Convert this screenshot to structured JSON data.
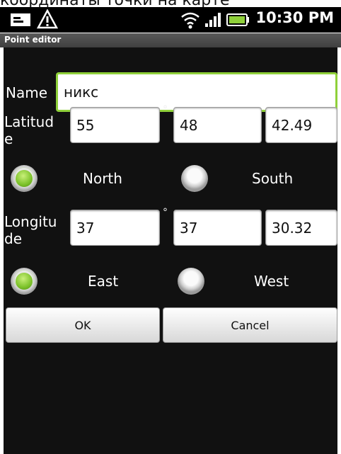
{
  "top_text": "координаты точки на карте",
  "status": {
    "time": "10:30 PM"
  },
  "title": "Point editor",
  "name": {
    "label": "Name",
    "value": "никс"
  },
  "latitude": {
    "label_line1": "Latitud",
    "label_line2": "e",
    "degrees": "55",
    "degree_symbol": "°",
    "minutes": "48",
    "seconds": "42.49",
    "options": [
      "North",
      "South"
    ],
    "selected": "North"
  },
  "longitude": {
    "label_line1": "Longitu",
    "label_line2": "de",
    "degrees": "37",
    "degree_symbol": "°",
    "minutes": "37",
    "seconds": "30.32",
    "options": [
      "East",
      "West"
    ],
    "selected": "East"
  },
  "buttons": {
    "ok": "OK",
    "cancel": "Cancel"
  },
  "colors": {
    "accent": "#8fd03a",
    "background": "#111111",
    "status_bar": "#000000"
  },
  "icons": [
    "message-icon",
    "warning-icon",
    "wifi-icon",
    "signal-icon",
    "battery-icon"
  ]
}
